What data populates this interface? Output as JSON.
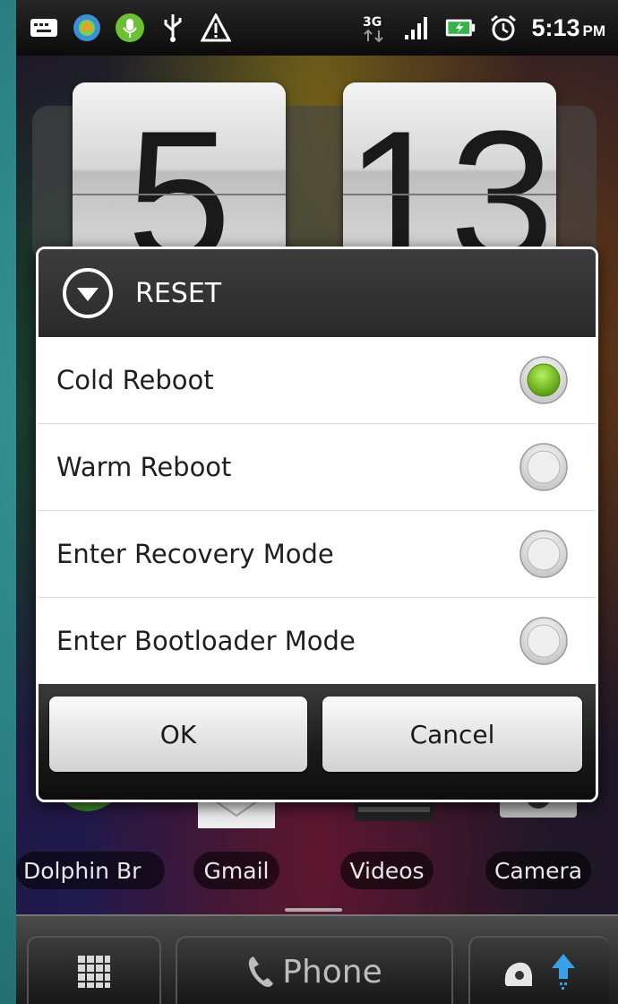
{
  "status_bar": {
    "time": "5:13",
    "ampm": "PM",
    "icons": [
      "keyboard-icon",
      "sync-icon",
      "microphone-icon",
      "usb-icon",
      "warning-icon",
      "3g-icon",
      "signal-icon",
      "battery-charging-icon",
      "alarm-icon"
    ]
  },
  "clock_widget": {
    "hour": "5",
    "minute": "13"
  },
  "home_apps": [
    {
      "label": "Dolphin Br"
    },
    {
      "label": "Gmail"
    },
    {
      "label": "Videos"
    },
    {
      "label": "Camera"
    }
  ],
  "dock": {
    "phone_label": "Phone"
  },
  "dialog": {
    "title": "RESET",
    "options": [
      {
        "label": "Cold Reboot",
        "selected": true
      },
      {
        "label": "Warm Reboot",
        "selected": false
      },
      {
        "label": "Enter Recovery Mode",
        "selected": false
      },
      {
        "label": "Enter Bootloader Mode",
        "selected": false
      }
    ],
    "ok_label": "OK",
    "cancel_label": "Cancel"
  },
  "colors": {
    "radio_selected": "#7dc21e",
    "header_bg": "#333333",
    "dialog_border": "#ffffff"
  }
}
